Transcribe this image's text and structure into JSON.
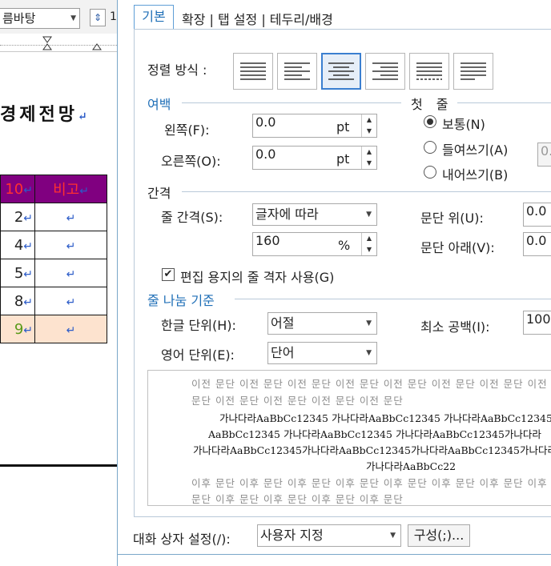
{
  "doc": {
    "font_name": "름바탕",
    "spacing_value": "1",
    "heading": "경제전망",
    "return_mark": "↵",
    "table": {
      "header": [
        "10",
        "비고"
      ],
      "rows": [
        "2",
        "4",
        "5",
        "8",
        "9"
      ]
    }
  },
  "dialog": {
    "tabs": {
      "basic": "기본",
      "others": "확장 | 탭 설정 | 테두리/배경"
    },
    "align": {
      "label": "정렬 방식 :",
      "icons": [
        "justify-align-icon",
        "left-align-icon",
        "center-align-icon",
        "right-align-icon",
        "distribute-align-icon",
        "divide-align-icon"
      ],
      "selected": "center-align-icon"
    },
    "margin": {
      "title": "여백",
      "left_label": "왼쪽(F):",
      "left_value": "0.0",
      "right_label": "오른쪽(O):",
      "right_value": "0.0",
      "unit": "pt"
    },
    "first_line": {
      "title": "첫 줄",
      "options": [
        "보통(N)",
        "들여쓰기(A)",
        "내어쓰기(B)"
      ],
      "selected": "보통(N)",
      "value_stub": "0."
    },
    "spacing": {
      "title": "간격",
      "line_label": "줄 간격(S):",
      "line_type": "글자에 따라",
      "line_value": "160",
      "line_unit": "%",
      "above_label": "문단 위(U):",
      "above_value": "0.0",
      "below_label": "문단 아래(V):",
      "below_value": "0.0",
      "grid_check_label": "편집 용지의 줄 격자 사용(G)",
      "grid_checked": true
    },
    "line_break": {
      "title": "줄 나눔 기준",
      "korean_label": "한글 단위(H):",
      "korean_value": "어절",
      "english_label": "영어 단위(E):",
      "english_value": "단어",
      "min_space_label": "최소 공백(I):",
      "min_space_value": "100"
    },
    "preview": {
      "prev_line1": "이전 문단 이전 문단 이전 문단 이전 문단 이전 문단 이전 문단 이전 문단 이전",
      "prev_line2": "문단 이전 문단 이전 문단 이전 문단 이전 문단",
      "body1": "가나다라AaBbCc12345 가나다라AaBbCc12345 가나다라AaBbCc12345",
      "body2": "AaBbCc12345 가나다라AaBbCc12345 가나다라AaBbCc12345가나다라",
      "body3": "가나다라AaBbCc12345가나다라AaBbCc12345가나다라AaBbCc12345가나다라",
      "body4": "가나다라AaBbCc22",
      "next_line1": "이후 문단 이후 문단 이후 문단 이후 문단 이후 문단 이후 문단 이후 문단 이후",
      "next_line2": "문단 이후 문단 이후 문단 이후 문단 이후 문단"
    },
    "footer": {
      "settings_label": "대화 상자 설정(/):",
      "settings_value": "사용자 지정",
      "configure_button": "구성(;)..."
    }
  }
}
